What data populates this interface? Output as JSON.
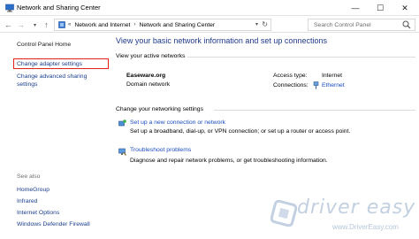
{
  "window": {
    "title": "Network and Sharing Center",
    "buttons": {
      "minimize": "—",
      "maximize": "☐",
      "close": "✕"
    }
  },
  "address_bar": {
    "back": "←",
    "forward": "→",
    "up": "↑",
    "crumbs": [
      "Network and Internet",
      "Network and Sharing Center"
    ],
    "search_placeholder": "Search Control Panel"
  },
  "left_pane": {
    "home": "Control Panel Home",
    "links": [
      "Change adapter settings",
      "Change advanced sharing",
      "settings"
    ],
    "see_also_title": "See also",
    "see_also": [
      "HomeGroup",
      "Infrared",
      "Internet Options",
      "Windows Defender Firewall"
    ]
  },
  "main": {
    "heading": "View your basic network information and set up connections",
    "active_networks_title": "View your active networks",
    "network": {
      "name": "Easeware.org",
      "type": "Domain network",
      "access_type_label": "Access type:",
      "access_type_value": "Internet",
      "connections_label": "Connections:",
      "connections_value": "Ethernet"
    },
    "change_settings_title": "Change your networking settings",
    "tasks": [
      {
        "link": "Set up a new connection or network",
        "desc": "Set up a broadband, dial-up, or VPN connection; or set up a router or access point."
      },
      {
        "link": "Troubleshoot problems",
        "desc": "Diagnose and repair network problems, or get troubleshooting information."
      }
    ]
  },
  "watermark": {
    "text": "driver easy",
    "url": "www.DriverEasy.com"
  },
  "colors": {
    "link": "#1a4cc2",
    "heading": "#1e3a8a",
    "highlight_box": "#e2231a"
  }
}
